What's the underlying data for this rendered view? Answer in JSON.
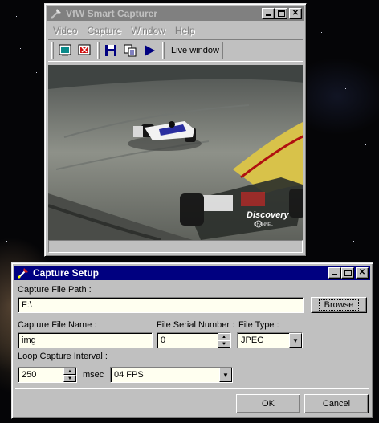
{
  "capturer": {
    "title": "VfW Smart Capturer",
    "menu": [
      "Video",
      "Capture",
      "Window",
      "Help"
    ],
    "toolbar": {
      "live_window_label": "Live window",
      "icons": [
        "monitor-icon",
        "stop-icon",
        "save-icon",
        "copy-icon",
        "play-icon"
      ]
    },
    "video": {
      "watermark_text": "Discovery",
      "watermark_subtext": "CHANNEL"
    }
  },
  "setup": {
    "title": "Capture Setup",
    "file_path_label": "Capture File Path :",
    "file_path_value": "F:\\",
    "browse_label": "Browse",
    "file_name_label": "Capture File Name :",
    "file_name_value": "img",
    "serial_label": "File Serial Number :",
    "serial_value": "0",
    "file_type_label": "File Type :",
    "file_type_value": "JPEG",
    "interval_label": "Loop Capture Interval :",
    "interval_value": "250",
    "interval_unit": "msec",
    "fps_value": "04 FPS",
    "ok_label": "OK",
    "cancel_label": "Cancel"
  },
  "colors": {
    "active_title": "#000080",
    "inactive_title": "#808080",
    "window_face": "#c0c0c0",
    "field_bg": "#fffff0"
  }
}
